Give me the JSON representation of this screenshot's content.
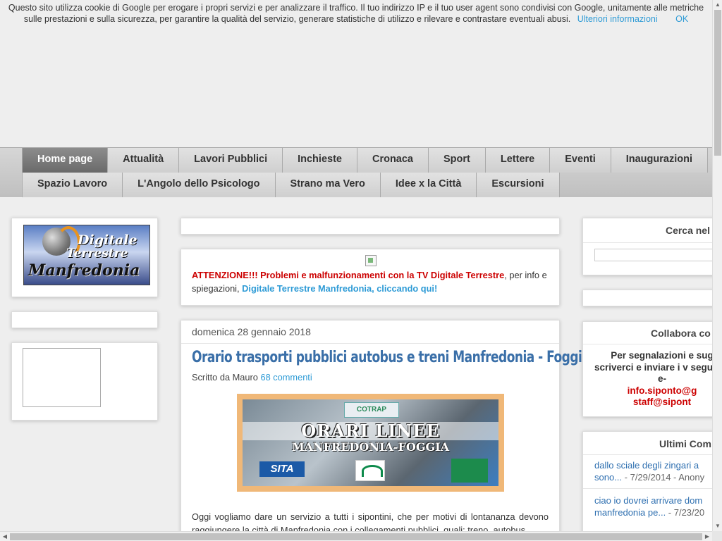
{
  "cookie": {
    "text": "Questo sito utilizza cookie di Google per erogare i propri servizi e per analizzare il traffico. Il tuo indirizzo IP e il tuo user agent sono condivisi con Google, unitamente alle metriche sulle prestazioni e sulla sicurezza, per garantire la qualità del servizio, generare statistiche di utilizzo e rilevare e contrastare eventuali abusi.",
    "more_link": "Ulteriori informazioni",
    "ok": "OK"
  },
  "nav": {
    "row1": [
      "Home page",
      "Attualità",
      "Lavori Pubblici",
      "Inchieste",
      "Cronaca",
      "Sport",
      "Lettere",
      "Eventi",
      "Inaugurazioni"
    ],
    "row2": [
      "Spazio Lavoro",
      "L'Angolo dello Psicologo",
      "Strano ma Vero",
      "Idee x la Città",
      "Escursioni"
    ],
    "active": "Home page"
  },
  "logo": {
    "line1": "Digitale",
    "line2": "Terrestre",
    "line3": "Manfredonia"
  },
  "notice": {
    "red": "ATTENZIONE!!! Problemi e malfunzionamenti con la TV Digitale Terrestre",
    "mid": ", per info e spiegazioni, ",
    "link": "Digitale Terrestre Manfredonia, cliccando qui!"
  },
  "post": {
    "date": "domenica 28 gennaio 2018",
    "title": "Orario trasporti pubblici autobus e treni Manfredonia - Foggia",
    "byline_prefix": "Scritto da Mauro",
    "comments_link": "68 commenti",
    "banner": {
      "line1": "ORARI LINEE",
      "line2": "MANFREDONIA-FOGGIA",
      "logo_sita": "SITA",
      "logo_cotrap": "COTRAP"
    },
    "body": "Oggi vogliamo dare un servizio a tutti i sipontini, che per motivi di lontananza devono raggiungere la città di Manfredonia con i collegamenti pubblici, quali: treno, autobus,"
  },
  "sidebar_right": {
    "search_title": "Cerca nel",
    "search_value": "",
    "collab_title": "Collabora co",
    "collab_text": "Per segnalazioni e sug scriverci e inviare i v seguenti e-",
    "collab_mail1": "info.siponto@g",
    "collab_mail2": "staff@sipont",
    "comments_title": "Ultimi Com",
    "comments": [
      {
        "link_line1": "dallo sciale degli zingari a",
        "link_line2": "sono...",
        "meta": " - 7/29/2014 - Anony"
      },
      {
        "link_line1": "ciao io dovrei arrivare dom",
        "link_line2": "manfredonia pe...",
        "meta": " - 7/23/20"
      }
    ]
  },
  "colors": {
    "accent_blue": "#2e9bd6",
    "title_blue": "#3a6fa8",
    "alert_red": "#cc0000",
    "nav_active": "#7a7a7a"
  }
}
